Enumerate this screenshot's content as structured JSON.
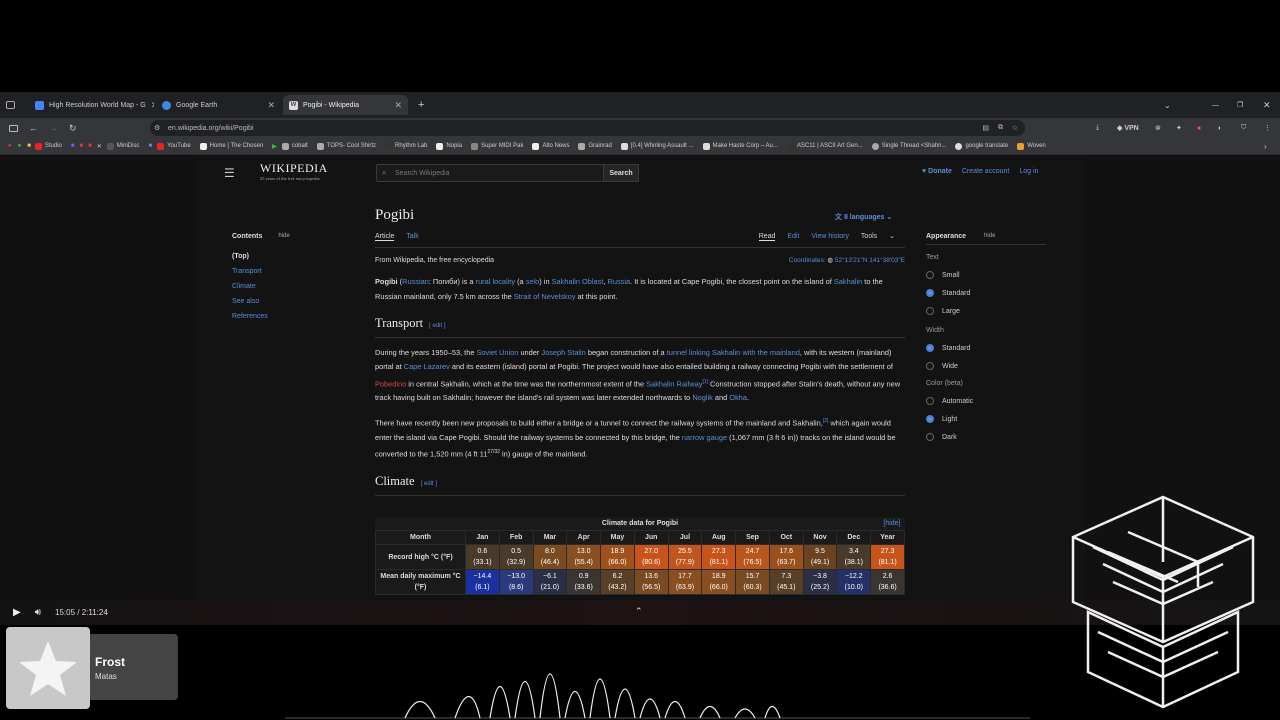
{
  "browser": {
    "tabs": [
      {
        "label": "High Resolution World Map - G",
        "color": "#4285f4"
      },
      {
        "label": "Google Earth",
        "color": "#3c8be0"
      },
      {
        "label": "Pogibi - Wikipedia",
        "color": "#ccc",
        "active": true
      }
    ],
    "new_tab": "+",
    "url": "en.wikipedia.org/wiki/Pogibi",
    "vpn": "VPN",
    "bookmarks": [
      {
        "label": "Studio",
        "color": "#e22"
      },
      {
        "label": "MiniDisc",
        "color": "#555"
      },
      {
        "label": "YouTube",
        "color": "#e22"
      },
      {
        "label": "Home | The Chosen",
        "color": "#eee"
      },
      {
        "label": "cobalt",
        "color": "#aaa"
      },
      {
        "label": "TOPS- Cool Shirtz",
        "color": "#aaa"
      },
      {
        "label": "Rhythm Lab",
        "color": "#333"
      },
      {
        "label": "Nopia",
        "color": "#eee"
      },
      {
        "label": "Super MIDI Pak",
        "color": "#888"
      },
      {
        "label": "Alto News",
        "color": "#eee"
      },
      {
        "label": "Grainrad",
        "color": "#aaa"
      },
      {
        "label": "[0.4] Whirling Assault ...",
        "color": "#ddd"
      },
      {
        "label": "Make Haste Corp – Au...",
        "color": "#ddd"
      },
      {
        "label": "ASC11 | ASCII Art Gen...",
        "color": "#333"
      },
      {
        "label": "Single Thread <Shahn...",
        "color": "#aaa"
      },
      {
        "label": "google translate",
        "color": "#ddd"
      },
      {
        "label": "Woven",
        "color": "#e8a030"
      }
    ]
  },
  "wiki": {
    "logo_title": "WIKIPEDIA",
    "logo_sub": "25 years of the free encyclopedia",
    "search_placeholder": "Search Wikipedia",
    "search_button": "Search",
    "donate": "Donate",
    "create_account": "Create account",
    "login": "Log in",
    "title": "Pogibi",
    "languages": "8 languages",
    "tabs_left": [
      "Article",
      "Talk"
    ],
    "tabs_right": [
      "Read",
      "Edit",
      "View history",
      "Tools"
    ],
    "from": "From Wikipedia, the free encyclopedia",
    "coordinates_label": "Coordinates:",
    "coordinates_value": "52°13′21″N 141°38′03″E",
    "toc": {
      "title": "Contents",
      "hide": "hide",
      "items": [
        "(Top)",
        "Transport",
        "Climate",
        "See also",
        "References"
      ]
    },
    "appearance": {
      "title": "Appearance",
      "hide": "hide",
      "text_label": "Text",
      "text_options": [
        "Small",
        "Standard",
        "Large"
      ],
      "width_label": "Width",
      "width_options": [
        "Standard",
        "Wide"
      ],
      "color_label": "Color (beta)",
      "color_options": [
        "Automatic",
        "Light",
        "Dark"
      ]
    },
    "intro": {
      "p1_bold": "Pogibi",
      "p1_a": " (",
      "p1_link1": "Russian",
      "p1_b": ": Погиби) is a ",
      "p1_link2": "rural locality",
      "p1_c": " (a ",
      "p1_link3": "selo",
      "p1_d": ") in ",
      "p1_link4": "Sakhalin Oblast",
      "p1_e": ", ",
      "p1_link5": "Russia",
      "p1_f": ". It is located at Cape Pogibi, the closest point on the island of ",
      "p1_link6": "Sakhalin",
      "p1_g": " to the Russian mainland, only 7.5 km across the ",
      "p1_link7": "Strait of Nevelskoy",
      "p1_h": " at this point."
    },
    "transport": {
      "heading": "Transport",
      "edit": "[ edit ]",
      "p1_a": "During the years 1950–53, the ",
      "p1_l1": "Soviet Union",
      "p1_b": " under ",
      "p1_l2": "Joseph Stalin",
      "p1_c": " began construction of a ",
      "p1_l3": "tunnel linking Sakhalin with the mainland",
      "p1_d": ", with its western (mainland) portal at ",
      "p1_l4": "Cape Lazarev",
      "p1_e": " and its eastern (island) portal at Pogibi. The project would have also entailed building a railway connecting Pogibi with the settlement of ",
      "p1_l5": "Pobedino",
      "p1_f": " in central Sakhalin, which at the time was the northernmost extent of the ",
      "p1_l6": "Sakhalin Railway",
      "p1_ref": "[1]",
      "p1_g": " Construction stopped after Stalin's death, without any new track having built on Sakhalin; however the island's rail system was later extended northwards to ",
      "p1_l7": "Noglik",
      "p1_h": " and ",
      "p1_l8": "Okha",
      "p1_i": ".",
      "p2_a": "There have recently been new proposals to build either a bridge or a tunnel to connect the railway systems of the mainland and Sakhalin,",
      "p2_ref": "[2]",
      "p2_b": " which again would enter the island via Cape Pogibi. Should the railway systems be connected by this bridge, the ",
      "p2_l1": "narrow gauge",
      "p2_c": " (1,067 mm (3 ft 6 in)) tracks on the island would be converted to the 1,520 mm (4 ft 11",
      "p2_frac": "27/32",
      "p2_d": " in) gauge of the mainland."
    },
    "climate": {
      "heading": "Climate",
      "edit": "[ edit ]",
      "table_title": "Climate data for Pogibi",
      "hide": "[hide]",
      "months": [
        "Month",
        "Jan",
        "Feb",
        "Mar",
        "Apr",
        "May",
        "Jun",
        "Jul",
        "Aug",
        "Sep",
        "Oct",
        "Nov",
        "Dec",
        "Year"
      ],
      "rows": [
        {
          "label": "Record high °C (°F)",
          "cells": [
            [
              "0.6",
              "(33.1)"
            ],
            [
              "0.5",
              "(32.9)"
            ],
            [
              "8.0",
              "(46.4)"
            ],
            [
              "13.0",
              "(55.4)"
            ],
            [
              "18.9",
              "(66.0)"
            ],
            [
              "27.0",
              "(80.6)"
            ],
            [
              "25.5",
              "(77.9)"
            ],
            [
              "27.3",
              "(81.1)"
            ],
            [
              "24.7",
              "(76.5)"
            ],
            [
              "17.6",
              "(63.7)"
            ],
            [
              "9.5",
              "(49.1)"
            ],
            [
              "3.4",
              "(38.1)"
            ],
            [
              "27.3",
              "(81.1)"
            ]
          ],
          "colors": [
            "#4a3a2a",
            "#4a3a2a",
            "#7a4a20",
            "#8a4f1e",
            "#a0521a",
            "#c8541a",
            "#c0561c",
            "#c8541a",
            "#b8561c",
            "#9a4f1c",
            "#6a4222",
            "#4a3a2a",
            "#c8541a"
          ]
        },
        {
          "label": "Mean daily maximum °C (°F)",
          "cells": [
            [
              "−14.4",
              "(6.1)"
            ],
            [
              "−13.0",
              "(8.6)"
            ],
            [
              "−6.1",
              "(21.0)"
            ],
            [
              "0.9",
              "(33.6)"
            ],
            [
              "6.2",
              "(43.2)"
            ],
            [
              "13.6",
              "(56.5)"
            ],
            [
              "17.7",
              "(63.9)"
            ],
            [
              "18.9",
              "(66.0)"
            ],
            [
              "15.7",
              "(60.3)"
            ],
            [
              "7.3",
              "(45.1)"
            ],
            [
              "−3.8",
              "(25.2)"
            ],
            [
              "−12.2",
              "(10.0)"
            ],
            [
              "2.6",
              "(36.6)"
            ]
          ],
          "colors": [
            "#1a2fa0",
            "#2a3a7a",
            "#2a2f45",
            "#3a3530",
            "#5a3f28",
            "#7a4a22",
            "#8a4e20",
            "#8a4e20",
            "#7a4a22",
            "#5a3f28",
            "#2a2f45",
            "#243068",
            "#3a3530"
          ]
        }
      ]
    }
  },
  "player": {
    "time": "15:05 / 2:11:24",
    "track_title": "Frost",
    "track_artist": "Matas"
  }
}
